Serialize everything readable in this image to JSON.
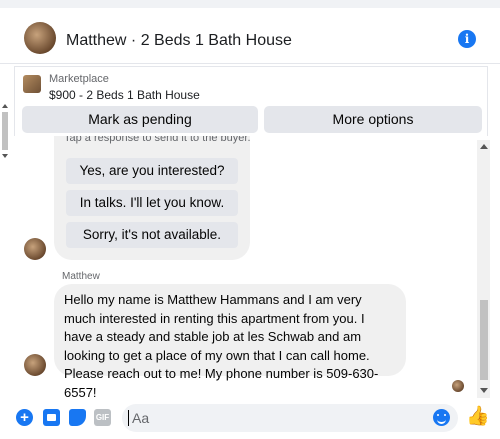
{
  "conversation": {
    "title": "Matthew · 2 Beds 1 Bath House",
    "info_icon": "info-icon"
  },
  "marketplace": {
    "label": "Marketplace",
    "listing": "$900 - 2 Beds 1 Bath House"
  },
  "actions": {
    "pending_label": "Mark as pending",
    "options_label": "More options"
  },
  "quick_replies": {
    "hint": "Tap a response to send it to the buyer.",
    "items": [
      "Yes, are you interested?",
      "In talks. I'll let you know.",
      "Sorry, it's not available."
    ]
  },
  "message": {
    "sender": "Matthew",
    "text": "Hello my name is Matthew Hammans and I am very much interested in renting this apartment from you. I have a steady and stable job at les Schwab and am looking to get a place of my own that I can call home. Please reach out to me! My phone number is 509-630-6557!"
  },
  "composer": {
    "placeholder": "Aa",
    "icons": [
      "plus-icon",
      "photo-icon",
      "sticker-icon",
      "gif-icon",
      "emoji-icon",
      "thumbs-up-icon"
    ],
    "gif_label": "GIF",
    "like_glyph": "👍"
  },
  "colors": {
    "accent": "#1877f2",
    "bubble": "#f0f0f0",
    "button": "#e4e6eb"
  }
}
